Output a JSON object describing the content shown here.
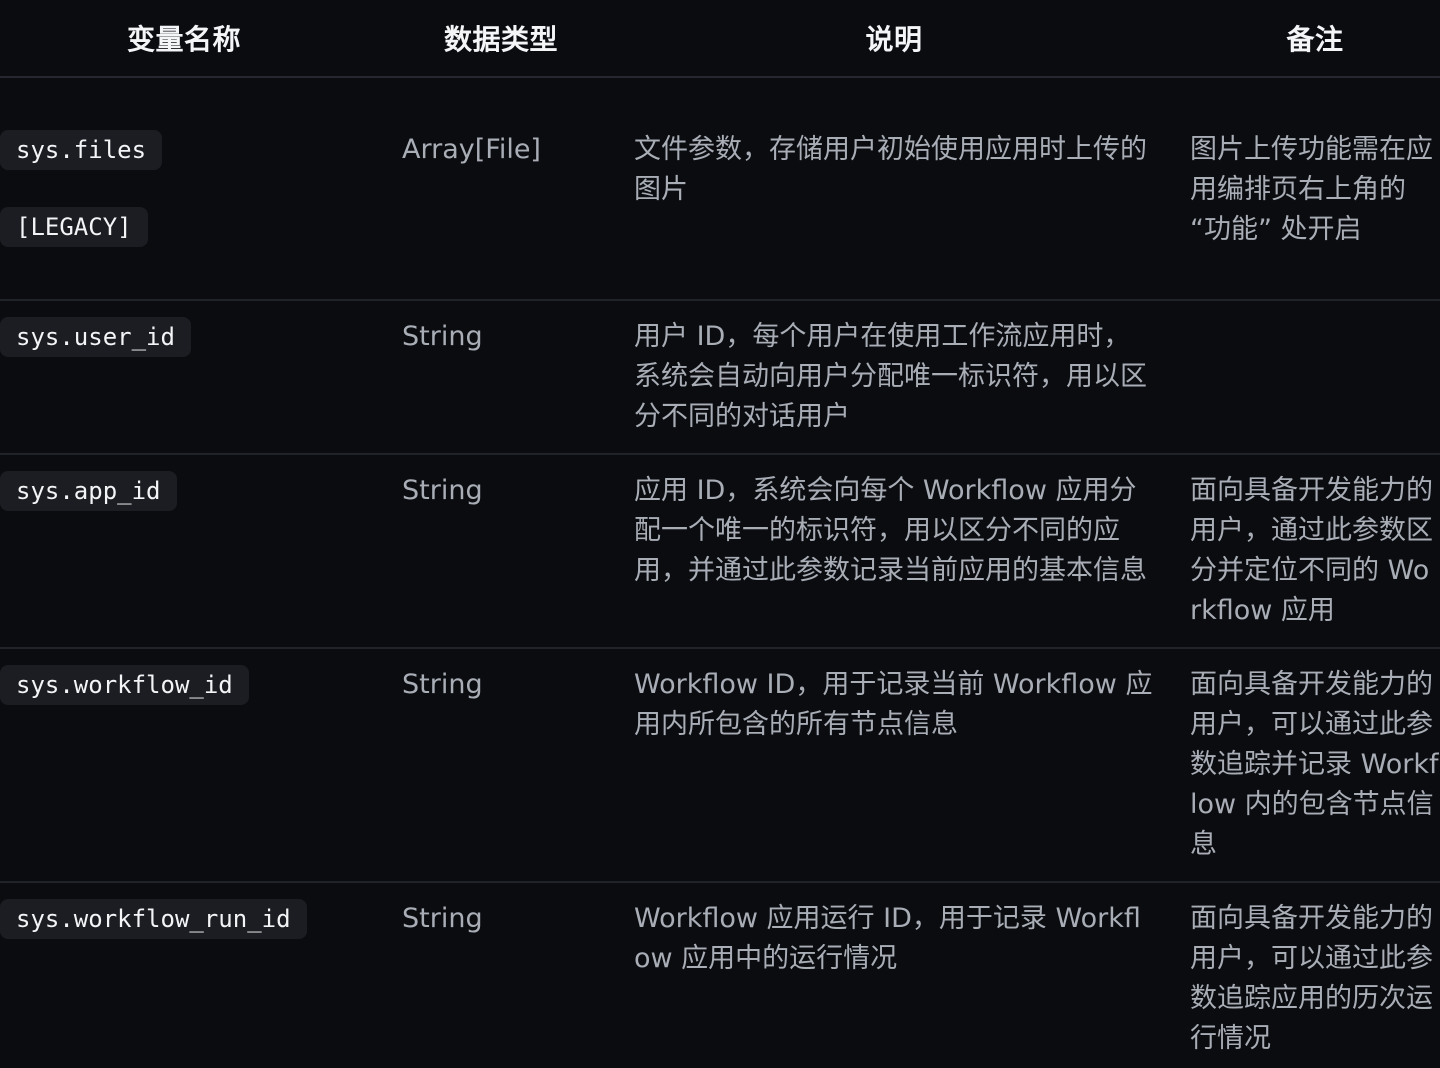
{
  "table": {
    "headers": [
      "变量名称",
      "数据类型",
      "说明",
      "备注"
    ],
    "rows": [
      {
        "variable": "sys.files",
        "variable_extra": "[LEGACY]",
        "type": "Array[File]",
        "description": "文件参数，存储用户初始使用应用时上传的图片",
        "note": "图片上传功能需在应用编排页右上角的 “功能” 处开启"
      },
      {
        "variable": "sys.user_id",
        "type": "String",
        "description": "用户 ID，每个用户在使用工作流应用时，系统会自动向用户分配唯一标识符，用以区分不同的对话用户",
        "note": ""
      },
      {
        "variable": "sys.app_id",
        "type": "String",
        "description": "应用 ID，系统会向每个 Workflow 应用分配一个唯一的标识符，用以区分不同的应用，并通过此参数记录当前应用的基本信息",
        "note": "面向具备开发能力的用户，通过此参数区分并定位不同的 Workflow 应用"
      },
      {
        "variable": "sys.workflow_id",
        "type": "String",
        "description": "Workflow ID，用于记录当前 Workflow 应用内所包含的所有节点信息",
        "note": "面向具备开发能力的用户，可以通过此参数追踪并记录 Workflow 内的包含节点信息"
      },
      {
        "variable": "sys.workflow_run_id",
        "type": "String",
        "description": "Workflow 应用运行 ID，用于记录 Workflow 应用中的运行情况",
        "note": "面向具备开发能力的用户，可以通过此参数追踪应用的历次运行情况"
      }
    ]
  }
}
